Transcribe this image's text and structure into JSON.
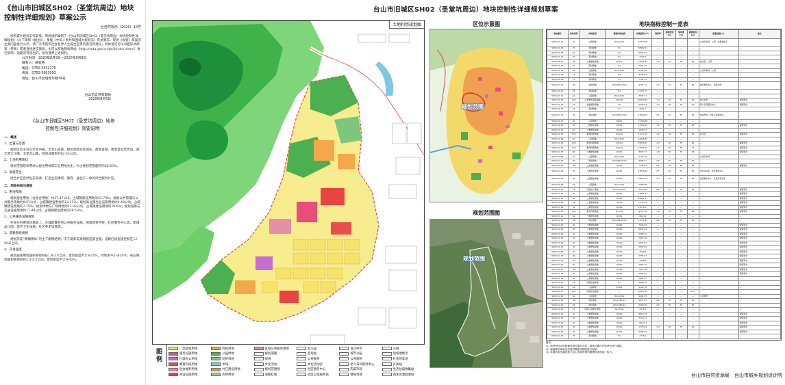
{
  "notice": {
    "title_line1": "《台山市旧城区SH02（圣堂坑周边）地块",
    "title_line2": "控制性详细规划》草案公示",
    "ref": "台自然规示（2020）10号",
    "para1": "按照城乡规划工作安排，我局组织编制了《台山市旧城区SH02（圣堂坑周边）地块控制性详细规划》（以下简称《规划》）。根据《中华人民共和国城乡规划法》有关要求，现将《规划》草案的主要内容进行公示，请广大市民和社会各界人士提出宝贵的意见和建议，具体意见可以书面形式邮寄（传真）或者直接送交我局，也可以登陆我局网站（http://cnta.gov.cn/gtj/bindex.shtml）进行反映，逾期没有提出的，视为放弃上述权利。",
    "period": "公示时间：2020年8月9日—2020年9月8日",
    "contact": "联系人：赖虹燕",
    "phone": "电话：0750-5552175",
    "fax": "传真：0750-5663093",
    "address": "地址：台山市台城龙华巷34号",
    "sign_org": "台山市自然资源局",
    "sign_date": "2020年8月9日",
    "plan_title1": "《台山市旧城区SH02（圣堂坑周边）地块",
    "plan_title2": "控制性详细规划》简要说明",
    "s1": "一、概述",
    "s1_1": "1、位置与范围",
    "s1_1p": "规划区位于台山市区中部，北邻山东路，规划范围东至湖东，西至金湖，南至圣堂坑周边，西北至大汉路，北至北山路，规划总面积约82.43公顷。",
    "s1_2": "2、土地利用现状",
    "s1_2p": "规划范围现状用地以居住用地和工业用地为主，约占规划范围面积的58.83%。",
    "s1_3": "3、发展定位",
    "s1_3p": "结合片区自然生态资源，打造生态休闲、教育、居住于一体的综合服务片区。",
    "s2": "二、用地布局与规划",
    "s2_1": "1、用地布局",
    "s2_1p": "规划居住用地（含混合用地）约27.47公顷，占城镇建设用地的43.73%；规划公共管理与公共服务用地约8.97公顷，占城镇建设用地的14.31%；规划商业服务业设施用地约4.49公顷，占城镇建设用地的7.15%；规划绿地与广场用地约13.93公顷，占城镇建设用地的20.6%；规划道路与交通设施用地约17.88公顷，占城镇建设用地的28.53%。",
    "s2_2": "2、公共服务设施规划",
    "s2_2p": "在充分利用现状基础上，合理配置各项公共服务设施，保留现有学校、社区服务中心等，新增幼儿园、医疗卫生设施、社区养老设施等。",
    "s2_3": "3、道路系统规划",
    "s2_3p": "规划形成“两横两纵”的主干路网结构，次干路和支路网络密度合理，道路红线宽度控制在12-50米之间。",
    "s2_4": "4、开发强度",
    "s2_4p": "规划居住用地容积率控制在1.8-2.6之间，建筑密度不大于25%，绿地率不小于30%；商业用地容积率控制在2.0-4.0之间，建筑密度不大于40%。"
  },
  "main_title": "台山市旧城区SH02（圣堂坑周边）地块控制性详细规划草案",
  "map": {
    "inner_title": "土地利用规划图"
  },
  "legend": {
    "label_1": "图",
    "label_2": "例",
    "items": [
      {
        "name": "二类居住用地",
        "color": "#f7e36b"
      },
      {
        "name": "商住用地",
        "color": "#f5a84a"
      },
      {
        "name": "区域公共服务用地",
        "color": "#e58fa8"
      },
      {
        "name": "幼儿园",
        "color": "#ffffff"
      },
      {
        "name": "台山中学",
        "color": "#ffffff"
      },
      {
        "name": "公厕",
        "color": "#ffffff"
      },
      {
        "name": "服务设施用地",
        "color": "#e94e7a"
      },
      {
        "name": "公园绿地",
        "color": "#4caf50"
      },
      {
        "name": "规划道路",
        "color": "#ffffff"
      },
      {
        "name": "变电站",
        "color": "#ffffff"
      },
      {
        "name": "城市公园",
        "color": "#ffffff"
      },
      {
        "name": "垃圾收集点",
        "color": "#ffffff"
      },
      {
        "name": "行政办公用地",
        "color": "#c76bd6"
      },
      {
        "name": "防护绿地",
        "color": "#7bc77e"
      },
      {
        "name": "绿线",
        "color": "#ffffff"
      },
      {
        "name": "公共服务",
        "color": "#ffffff"
      },
      {
        "name": "公共厕所",
        "color": "#ffffff"
      },
      {
        "name": "社会停车场",
        "color": "#ffffff"
      },
      {
        "name": "教育科研用地",
        "color": "#e94e4e"
      },
      {
        "name": "水域",
        "color": "#7ec8e3"
      },
      {
        "name": "文化活动",
        "color": "#ffffff"
      },
      {
        "name": "文化活动室",
        "color": "#ffffff"
      },
      {
        "name": "老人日间照料中心",
        "color": "#ffffff"
      },
      {
        "name": "开关站",
        "color": "#ffffff"
      },
      {
        "name": "社会福利用地",
        "color": "#f08cb0"
      },
      {
        "name": "村庄建设用地",
        "color": "#c9a36a"
      },
      {
        "name": "规划范围线",
        "color": "#ffffff"
      },
      {
        "name": "社区服务中心",
        "color": "#ffffff"
      },
      {
        "name": "肉菜市场",
        "color": "#ffffff"
      },
      {
        "name": "生活垃圾收集站",
        "color": "#ffffff"
      },
      {
        "name": "商业设施用地",
        "color": "#e94444"
      },
      {
        "name": "农林用地",
        "color": "#9fd47a"
      },
      {
        "name": "道路红线",
        "color": "#ffffff"
      },
      {
        "name": "社区卫生服务站",
        "color": "#ffffff"
      },
      {
        "name": "健身场地",
        "color": "#ffffff"
      },
      {
        "name": "再生资源回收站",
        "color": "#ffffff"
      }
    ]
  },
  "location_map": {
    "title": "区位示意图",
    "label": "规划范围"
  },
  "range_map": {
    "title": "规划范围图",
    "label": "规划范围"
  },
  "table": {
    "title": "地块指标控制一览表",
    "headers": [
      "地块编号",
      "用地代码",
      "用地性质",
      "兼容用地性质",
      "用地面积(m²)",
      "容积率",
      "建筑密度(%)",
      "绿地率(%)",
      "建筑限高(m)",
      "配套设施(个)",
      "备注"
    ],
    "rows": [
      [
        "SH02-01-01",
        "A2",
        "公园绿地",
        "R2/G1/S4",
        "17473.08",
        "—",
        "—",
        "—",
        "—",
        "公共停车场、公厕、垃圾收集点",
        "—"
      ],
      [
        "SH02-01-02",
        "E1",
        "农林用地",
        "E1",
        "38962.41",
        "—",
        "—",
        "—",
        "—",
        "—",
        "—"
      ],
      [
        "SH02-01-03",
        "E1",
        "农林用地",
        "E1",
        "60311.9",
        "—",
        "—",
        "—",
        "—",
        "—",
        "—"
      ],
      [
        "SH02-01-04",
        "E1",
        "农林用地",
        "E1",
        "3759.3",
        "—",
        "—",
        "—",
        "—",
        "—",
        "—"
      ],
      [
        "SH02-01-05",
        "R2",
        "二类居住用地",
        "R2/S2",
        "21635.14",
        "1.8",
        "30",
        "35",
        "45",
        "幼儿园、公厕",
        "—"
      ],
      [
        "SH02-01-06",
        "E1",
        "农林用地",
        "E1",
        "5661.45",
        "—",
        "—",
        "—",
        "—",
        "—",
        "—"
      ],
      [
        "SH02-01-07",
        "G1",
        "公园绿地",
        "R2/G1/S4",
        "2745.69",
        "—",
        "—",
        "—",
        "—",
        "公共停车场、公厕",
        "—"
      ],
      [
        "SH02-01-08",
        "E1",
        "农林用地",
        "E1",
        "8478.96",
        "—",
        "—",
        "—",
        "—",
        "—",
        "—"
      ],
      [
        "SH02-01-09",
        "E1",
        "农林用地",
        "E1",
        "7761.33",
        "—",
        "—",
        "—",
        "—",
        "—",
        "—"
      ],
      [
        "SH02-01-10",
        "Rb",
        "商住用地",
        "R2/A2/B1/S4/U",
        "9701.72",
        "2.5",
        "30",
        "35",
        "60",
        "社区服务中心、肉菜市场",
        "—"
      ],
      [
        "SH02-01-11",
        "E1",
        "农林用地",
        "E1",
        "11307.77",
        "—",
        "—",
        "—",
        "—",
        "—",
        "—"
      ],
      [
        "SH02-01-12",
        "G1",
        "公园绿地",
        "R2/G1/S4",
        "3097.17",
        "—",
        "—",
        "—",
        "—",
        "—",
        "—"
      ],
      [
        "SH02-01-13",
        "A33",
        "公共服务设施用地",
        "A33/A5",
        "20924.26",
        "1.2",
        "30",
        "35",
        "24",
        "台山中学",
        "保留现状"
      ],
      [
        "SH02-01-14",
        "A6",
        "社会福利用地",
        "A6",
        "4638.03",
        "1.0",
        "30",
        "35",
        "24",
        "老人日间照料中心",
        "保留现状"
      ],
      [
        "SH02-01-15",
        "E1",
        "农林用地",
        "E1",
        "2561.4",
        "—",
        "—",
        "—",
        "—",
        "—",
        "—"
      ],
      [
        "SH02-01-16",
        "Rb",
        "商住用地",
        "R2/A2/B1/S4/U",
        "13900.29",
        "2.6",
        "30",
        "35",
        "80",
        "肉菜市场、社区卫生服务站",
        "—"
      ],
      [
        "SH02-01-17",
        "G1",
        "公园绿地",
        "R2/G1",
        "11764.68",
        "—",
        "—",
        "—",
        "—",
        "—",
        "—"
      ],
      [
        "SH02-02-01",
        "R2",
        "二类居住用地",
        "R2/S2",
        "13504.64",
        "1.8",
        "30",
        "35",
        "45",
        "—",
        "保留现状"
      ],
      [
        "SH02-02-02",
        "R2",
        "二类居住用地",
        "R2/S2",
        "1636.37",
        "—",
        "—",
        "—",
        "—",
        "—",
        "—"
      ],
      [
        "SH02-02-03",
        "A33",
        "教育科研用地",
        "A33/A1",
        "27173.19",
        "1.0",
        "30",
        "35",
        "24",
        "幼儿园",
        "保留现状"
      ],
      [
        "SH02-02-04",
        "G1",
        "公园绿地",
        "R2/G1/S4",
        "14666.38",
        "—",
        "—",
        "—",
        "—",
        "—",
        "—"
      ],
      [
        "SH02-02-05",
        "A33",
        "教育科研用地",
        "A33/A1",
        "29935.67",
        "1.0",
        "30",
        "35",
        "24",
        "—",
        "保留现状"
      ],
      [
        "SH02-02-06",
        "A33",
        "教育科研用地",
        "A33/A1",
        "11595.32",
        "1.0",
        "30",
        "35",
        "24",
        "—",
        "保留现状"
      ],
      [
        "SH02-02-07",
        "R2",
        "二类居住用地",
        "R2/S2",
        "8397.77",
        "1.8",
        "30",
        "35",
        "45",
        "—",
        "保留现状"
      ],
      [
        "SH02-02-08",
        "G1",
        "公园绿地",
        "R2/G1/S4",
        "1244.18",
        "—",
        "—",
        "—",
        "—",
        "公共停车场",
        "—"
      ],
      [
        "SH02-02-09",
        "Rb",
        "商住用地",
        "R2/A2/B1/S4/U",
        "4966.22",
        "2.6",
        "30",
        "35",
        "60",
        "—",
        "—"
      ],
      [
        "SH02-03-01",
        "R2",
        "二类居住用地",
        "R2/S2",
        "7396.61",
        "1.8",
        "30",
        "35",
        "45",
        "—",
        "保留现状"
      ],
      [
        "SH02-03-02",
        "R2",
        "二类居住用地",
        "R2/S2",
        "13836.66",
        "2.5",
        "30",
        "35",
        "60",
        "文化活动室、社区服务中心",
        "—"
      ],
      [
        "SH02-03-03",
        "R2",
        "二类居住用地",
        "R2/S2",
        "19823.11",
        "2.5",
        "30",
        "35",
        "60",
        "社区服务中心、社区养老设施",
        "—"
      ],
      [
        "SH02-03-04",
        "G1",
        "公园绿地",
        "R2/G1/S4",
        "1288.88",
        "—",
        "—",
        "—",
        "—",
        "—",
        "—"
      ],
      [
        "SH02-03-05",
        "A1",
        "行政办公用地",
        "A1/A2/A3/A5",
        "2979.06",
        "2.0",
        "30",
        "35",
        "24",
        "—",
        "保留现状"
      ],
      [
        "SH02-03-06",
        "R2",
        "二类居住用地",
        "R2/S2",
        "13661.56",
        "—",
        "—",
        "—",
        "—",
        "—",
        "保留现状"
      ],
      [
        "SH02-03-07",
        "R2",
        "二类居住用地",
        "R2/S2",
        "62881.97",
        "—",
        "—",
        "—",
        "—",
        "—",
        "保留现状"
      ],
      [
        "SH02-03-08",
        "R2",
        "二类居住用地",
        "R2/S2",
        "7176.39",
        "—",
        "—",
        "—",
        "—",
        "—",
        "保留现状"
      ],
      [
        "SH02-03-09",
        "R2",
        "二类居住用地",
        "R2/S2",
        "13076.77",
        "—",
        "—",
        "—",
        "—",
        "—",
        "保留现状"
      ],
      [
        "SH02-03-10",
        "A33",
        "教育科研用地",
        "A33/A1",
        "9711.02",
        "1.0",
        "30",
        "35",
        "24",
        "—",
        "保留现状"
      ],
      [
        "SH02-03-11",
        "R2",
        "二类居住用地",
        "R2/S2",
        "866.31",
        "—",
        "—",
        "—",
        "—",
        "—",
        "—"
      ],
      [
        "SH02-04-01",
        "Rb",
        "商住用地",
        "R2/A2/B1/S4/U",
        "11131.43",
        "2.6",
        "30",
        "35",
        "60",
        "—",
        "—"
      ],
      [
        "SH02-04-02",
        "R2",
        "二类居住用地",
        "R2/S2",
        "7076.45",
        "—",
        "—",
        "—",
        "—",
        "—",
        "保留现状"
      ],
      [
        "SH02-04-03",
        "R2",
        "二类居住用地",
        "R2/S2",
        "8815.94",
        "—",
        "—",
        "—",
        "—",
        "—",
        "保留现状"
      ],
      [
        "SH02-04-04",
        "R2",
        "二类居住用地",
        "R2/S2",
        "5568.41",
        "—",
        "—",
        "—",
        "—",
        "—",
        "保留现状"
      ],
      [
        "SH02-04-05",
        "R2",
        "二类居住用地",
        "R2/S2",
        "7407.16",
        "—",
        "—",
        "—",
        "—",
        "—",
        "保留现状"
      ],
      [
        "SH02-04-06",
        "R2",
        "二类居住用地",
        "R2/S2",
        "6905.52",
        "—",
        "—",
        "—",
        "—",
        "—",
        "保留现状"
      ],
      [
        "SH02-04-07",
        "R2",
        "二类居住用地",
        "R2/S2",
        "2957.95",
        "—",
        "—",
        "—",
        "—",
        "—",
        "保留现状"
      ],
      [
        "SH02-04-08",
        "R2",
        "二类居住用地",
        "R2/S2",
        "3509.5",
        "—",
        "—",
        "—",
        "—",
        "—",
        "保留现状"
      ],
      [
        "SH02-04-09",
        "R2",
        "二类居住用地",
        "R2/S2",
        "2565.52",
        "—",
        "—",
        "—",
        "—",
        "—",
        "保留现状"
      ],
      [
        "SH02-04-10",
        "R2",
        "二类居住用地",
        "R2/S2",
        "1068.8",
        "—",
        "—",
        "—",
        "—",
        "—",
        "保留现状"
      ],
      [
        "SH02-04-11",
        "R2",
        "二类居住用地",
        "R2/S2",
        "1887.75",
        "—",
        "—",
        "—",
        "—",
        "—",
        "保留现状"
      ],
      [
        "SH02-04-12",
        "R2",
        "二类居住用地",
        "R2/S2",
        "1607.38",
        "—",
        "—",
        "—",
        "—",
        "—",
        "保留现状"
      ],
      [
        "SH02-04-13",
        "R2",
        "二类居住用地",
        "R2/S2",
        "5003.52",
        "—",
        "—",
        "—",
        "—",
        "—",
        "保留现状"
      ],
      [
        "SH02-04-14",
        "R2",
        "二类居住用地",
        "R2/S2",
        "7961.13",
        "—",
        "—",
        "—",
        "—",
        "—",
        "—"
      ],
      [
        "SH02-04-15",
        "E1",
        "村庄建设用地",
        "E1",
        "8689.35",
        "—",
        "—",
        "—",
        "—",
        "—",
        "—"
      ],
      [
        "SH02-04-16",
        "G1",
        "公园绿地",
        "R2/G1",
        "1304.78",
        "—",
        "—",
        "—",
        "—",
        "—",
        "—"
      ],
      [
        "SH02-04-17",
        "E14",
        "村庄建设用地",
        "—",
        "10887.44",
        "—",
        "—",
        "—",
        "11.5",
        "—",
        "—"
      ],
      [
        "SH02-04-18",
        "G1",
        "公园绿地",
        "R2/G1/S4",
        "4161.55",
        "—",
        "—",
        "—",
        "—",
        "公共厕所",
        "—"
      ],
      [
        "SH02-04-19",
        "Rb",
        "商住用地",
        "R2/A2/B1/S4",
        "6671.25",
        "2.6",
        "30",
        "35",
        "60",
        "—",
        "—"
      ],
      [
        "SH02-04-20",
        "Rb",
        "商住用地",
        "R2/A2/B1/S4",
        "6760.35",
        "2.6",
        "30",
        "35",
        "80",
        "—",
        "—"
      ],
      [
        "SH02-04-21",
        "A2",
        "区域公共服务用地",
        "A2/A5/A1",
        "2026.3",
        "—",
        "—",
        "—",
        "—",
        "—",
        "—"
      ],
      [
        "SH02-04-22",
        "R2",
        "二类居住用地",
        "R2/S2",
        "8818.18",
        "—",
        "—",
        "—",
        "—",
        "—",
        "保留现状"
      ],
      [
        "SH02-04-23",
        "R2",
        "二类居住用地",
        "R2/S2",
        "3115.27",
        "—",
        "—",
        "—",
        "—",
        "—",
        "保留现状"
      ],
      [
        "SH02-04-24",
        "R2",
        "二类居住用地",
        "R2/S2",
        "1813.54",
        "—",
        "—",
        "—",
        "—",
        "—",
        "保留现状"
      ],
      [
        "SH02-04-25",
        "R2",
        "二类居住用地",
        "R2/S2",
        "1725.59",
        "1.0",
        "30",
        "35",
        "24",
        "—",
        "保留现状"
      ],
      [
        "SH02-04-26",
        "R2",
        "二类居住用地",
        "R2/S2",
        "2389.15",
        "—",
        "—",
        "—",
        "—",
        "—",
        "保留现状"
      ],
      [
        "SH02-04-27",
        "E1",
        "农林用地",
        "E1",
        "1776.4",
        "—",
        "—",
        "—",
        "—",
        "—",
        "—"
      ]
    ]
  },
  "notes": {
    "n1": "备注：",
    "n2": "(1) 地块所标示的配套设施位置为示意，具体位置可在地块内进行调整。",
    "n3": "(2) 保留现状用地在改造时需按本规划进行控制。",
    "n4": "(3) 本规划未尽事宜按《台山市城市规划管理技术规定》执行。"
  },
  "footer": "台山市自然资源局　台山市城乡规划设计院"
}
